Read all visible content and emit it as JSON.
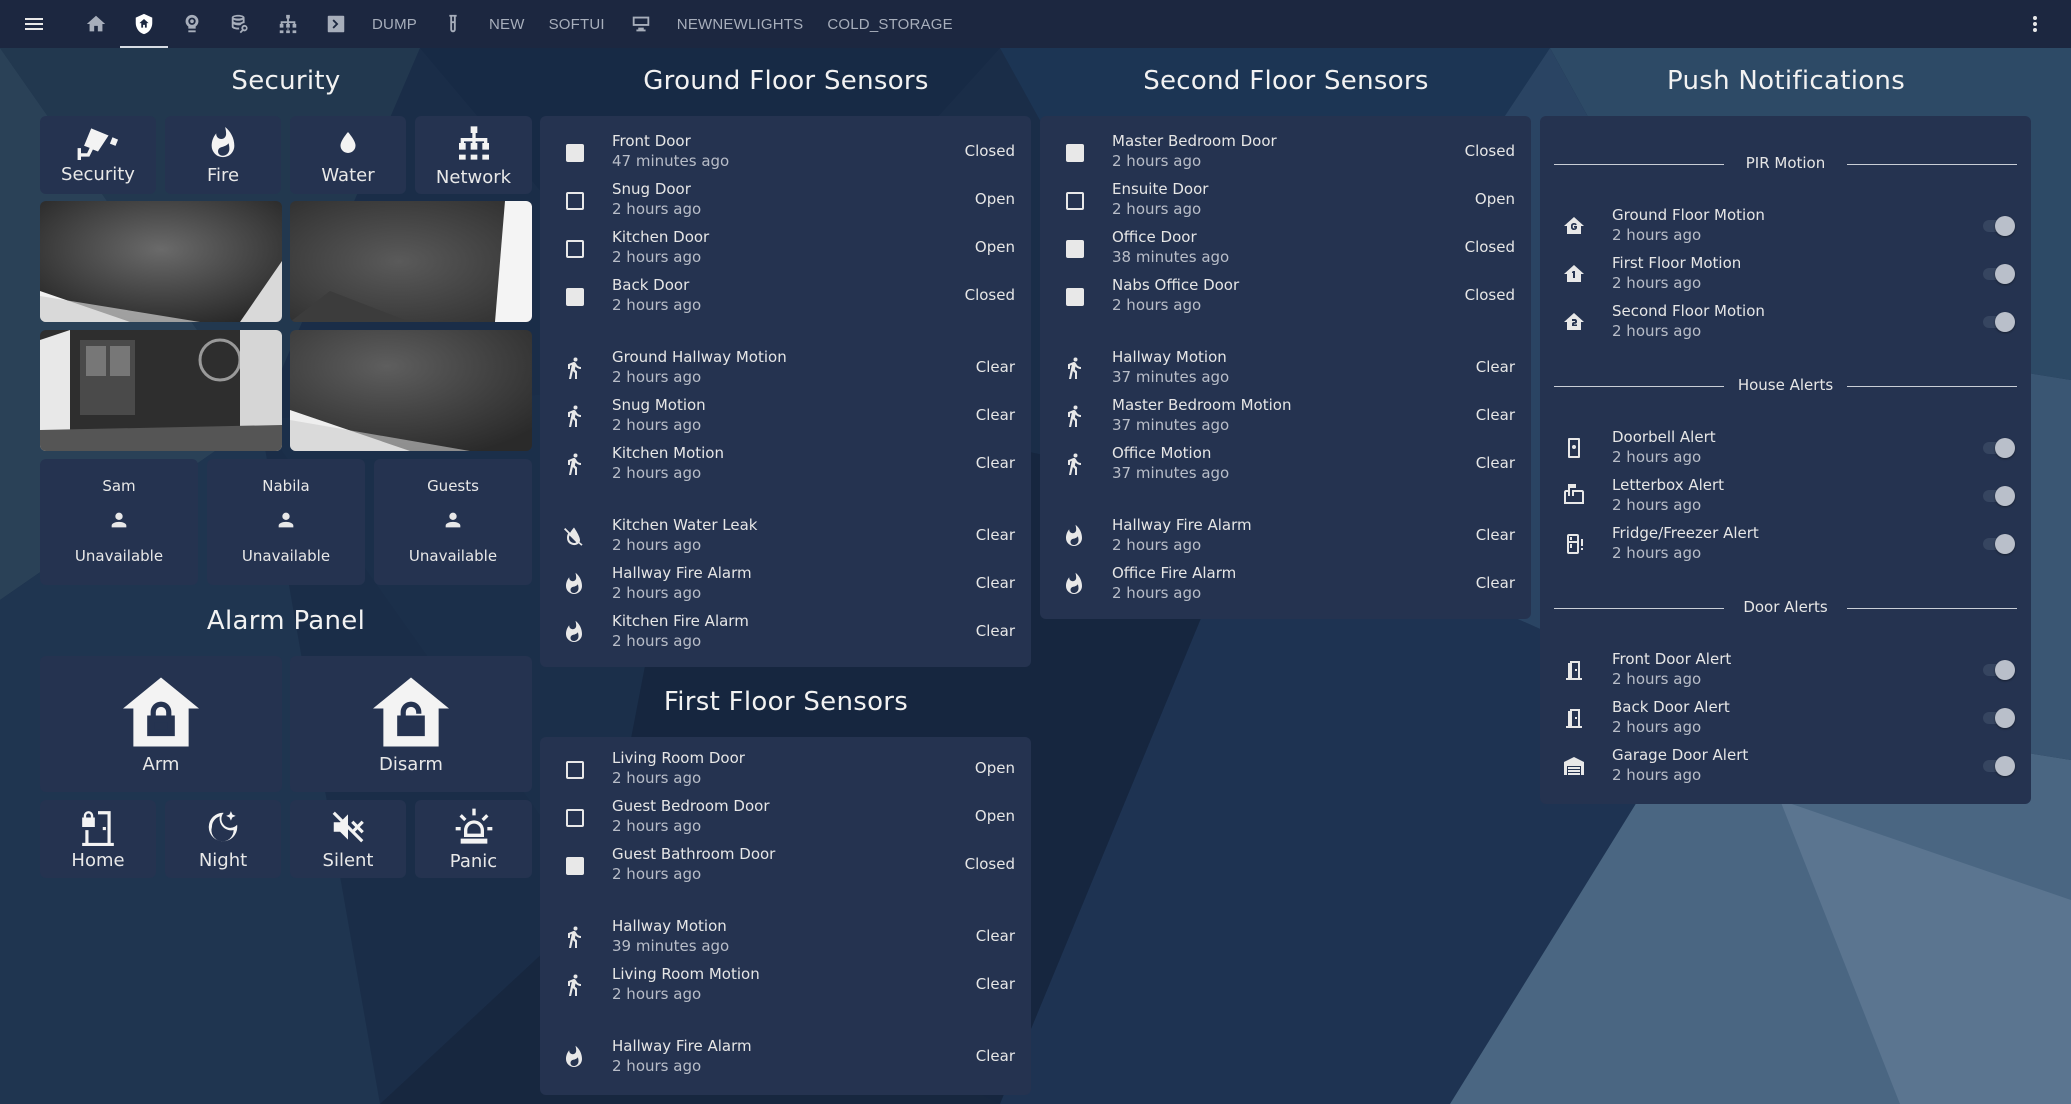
{
  "nav": {
    "tabs": [
      {
        "type": "icon",
        "icon": "home-icon"
      },
      {
        "type": "icon",
        "icon": "shield-home-icon",
        "active": true
      },
      {
        "type": "icon",
        "icon": "cctv-icon"
      },
      {
        "type": "icon",
        "icon": "search-database-icon"
      },
      {
        "type": "icon",
        "icon": "network-icon"
      },
      {
        "type": "icon",
        "icon": "chevron-box-icon"
      },
      {
        "type": "text",
        "label": "DUMP"
      },
      {
        "type": "icon",
        "icon": "test-tube-icon"
      },
      {
        "type": "text",
        "label": "NEW"
      },
      {
        "type": "text",
        "label": "SOFTUI"
      },
      {
        "type": "icon",
        "icon": "monitor-icon"
      },
      {
        "type": "text",
        "label": "NEWNEWLIGHTS"
      },
      {
        "type": "text",
        "label": "COLD_STORAGE"
      }
    ]
  },
  "security": {
    "title": "Security",
    "tiles": [
      {
        "label": "Security",
        "icon": "cctv-icon"
      },
      {
        "label": "Fire",
        "icon": "fire-icon"
      },
      {
        "label": "Water",
        "icon": "water-icon"
      },
      {
        "label": "Network",
        "icon": "network-icon"
      }
    ],
    "people": [
      {
        "name": "Sam",
        "state": "Unavailable"
      },
      {
        "name": "Nabila",
        "state": "Unavailable"
      },
      {
        "name": "Guests",
        "state": "Unavailable"
      }
    ]
  },
  "alarm": {
    "title": "Alarm Panel",
    "big": [
      {
        "label": "Arm",
        "icon": "house-lock-icon"
      },
      {
        "label": "Disarm",
        "icon": "house-unlock-icon"
      }
    ],
    "small": [
      {
        "label": "Home",
        "icon": "door-lock-icon"
      },
      {
        "label": "Night",
        "icon": "moon-star-icon"
      },
      {
        "label": "Silent",
        "icon": "volume-off-icon"
      },
      {
        "label": "Panic",
        "icon": "alarm-light-icon"
      }
    ]
  },
  "ground": {
    "title": "Ground Floor Sensors",
    "groups": [
      [
        {
          "name": "Front Door",
          "time": "47 minutes ago",
          "state": "Closed",
          "icon": "door-closed-icon"
        },
        {
          "name": "Snug Door",
          "time": "2 hours ago",
          "state": "Open",
          "icon": "door-open-icon"
        },
        {
          "name": "Kitchen Door",
          "time": "2 hours ago",
          "state": "Open",
          "icon": "door-open-icon"
        },
        {
          "name": "Back Door",
          "time": "2 hours ago",
          "state": "Closed",
          "icon": "door-closed-icon"
        }
      ],
      [
        {
          "name": "Ground Hallway Motion",
          "time": "2 hours ago",
          "state": "Clear",
          "icon": "walk-icon"
        },
        {
          "name": "Snug Motion",
          "time": "2 hours ago",
          "state": "Clear",
          "icon": "walk-icon"
        },
        {
          "name": "Kitchen Motion",
          "time": "2 hours ago",
          "state": "Clear",
          "icon": "walk-icon"
        }
      ],
      [
        {
          "name": "Kitchen Water Leak",
          "time": "2 hours ago",
          "state": "Clear",
          "icon": "water-off-icon"
        },
        {
          "name": "Hallway Fire Alarm",
          "time": "2 hours ago",
          "state": "Clear",
          "icon": "fire-icon"
        },
        {
          "name": "Kitchen Fire Alarm",
          "time": "2 hours ago",
          "state": "Clear",
          "icon": "fire-icon"
        }
      ]
    ]
  },
  "first": {
    "title": "First Floor Sensors",
    "groups": [
      [
        {
          "name": "Living Room Door",
          "time": "2 hours ago",
          "state": "Open",
          "icon": "door-open-icon"
        },
        {
          "name": "Guest Bedroom Door",
          "time": "2 hours ago",
          "state": "Open",
          "icon": "door-open-icon"
        },
        {
          "name": "Guest Bathroom Door",
          "time": "2 hours ago",
          "state": "Closed",
          "icon": "door-closed-icon"
        }
      ],
      [
        {
          "name": "Hallway Motion",
          "time": "39 minutes ago",
          "state": "Clear",
          "icon": "walk-icon"
        },
        {
          "name": "Living Room Motion",
          "time": "2 hours ago",
          "state": "Clear",
          "icon": "walk-icon"
        }
      ],
      [
        {
          "name": "Hallway Fire Alarm",
          "time": "2 hours ago",
          "state": "Clear",
          "icon": "fire-icon"
        }
      ]
    ]
  },
  "second": {
    "title": "Second Floor Sensors",
    "groups": [
      [
        {
          "name": "Master Bedroom Door",
          "time": "2 hours ago",
          "state": "Closed",
          "icon": "door-closed-icon"
        },
        {
          "name": "Ensuite Door",
          "time": "2 hours ago",
          "state": "Open",
          "icon": "door-open-icon"
        },
        {
          "name": "Office Door",
          "time": "38 minutes ago",
          "state": "Closed",
          "icon": "door-closed-icon"
        },
        {
          "name": "Nabs Office Door",
          "time": "2 hours ago",
          "state": "Closed",
          "icon": "door-closed-icon"
        }
      ],
      [
        {
          "name": "Hallway Motion",
          "time": "37 minutes ago",
          "state": "Clear",
          "icon": "walk-icon"
        },
        {
          "name": "Master Bedroom Motion",
          "time": "37 minutes ago",
          "state": "Clear",
          "icon": "walk-icon"
        },
        {
          "name": "Office Motion",
          "time": "37 minutes ago",
          "state": "Clear",
          "icon": "walk-icon"
        }
      ],
      [
        {
          "name": "Hallway Fire Alarm",
          "time": "2 hours ago",
          "state": "Clear",
          "icon": "fire-icon"
        },
        {
          "name": "Office Fire Alarm",
          "time": "2 hours ago",
          "state": "Clear",
          "icon": "fire-icon"
        }
      ]
    ]
  },
  "push": {
    "title": "Push Notifications",
    "sections": [
      {
        "heading": "PIR Motion",
        "items": [
          {
            "name": "Ground Floor Motion",
            "time": "2 hours ago",
            "icon": "home-floor-g-icon"
          },
          {
            "name": "First Floor Motion",
            "time": "2 hours ago",
            "icon": "home-floor-1-icon"
          },
          {
            "name": "Second Floor Motion",
            "time": "2 hours ago",
            "icon": "home-floor-2-icon"
          }
        ]
      },
      {
        "heading": "House Alerts",
        "items": [
          {
            "name": "Doorbell Alert",
            "time": "2 hours ago",
            "icon": "doorbell-icon"
          },
          {
            "name": "Letterbox Alert",
            "time": "2 hours ago",
            "icon": "mailbox-icon"
          },
          {
            "name": "Fridge/Freezer Alert",
            "time": "2 hours ago",
            "icon": "fridge-alert-icon"
          }
        ]
      },
      {
        "heading": "Door Alerts",
        "items": [
          {
            "name": "Front Door Alert",
            "time": "2 hours ago",
            "icon": "door-icon"
          },
          {
            "name": "Back Door Alert",
            "time": "2 hours ago",
            "icon": "door-icon"
          },
          {
            "name": "Garage Door Alert",
            "time": "2 hours ago",
            "icon": "garage-icon"
          }
        ]
      }
    ]
  }
}
